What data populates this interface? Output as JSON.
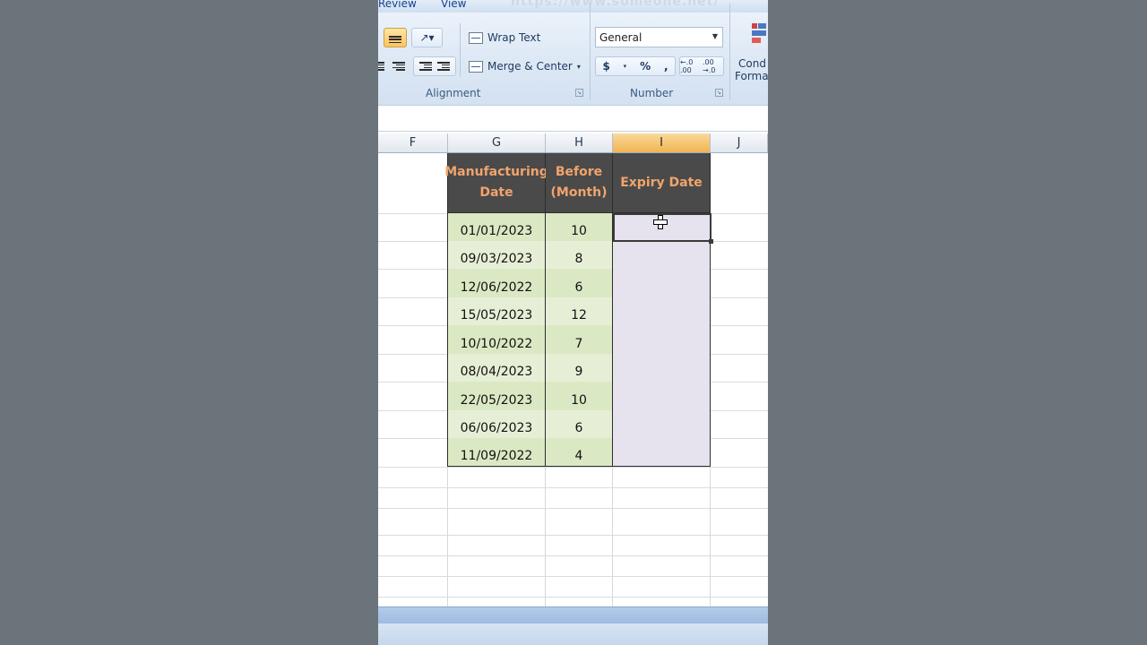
{
  "ribbon": {
    "tabs": [
      "Review",
      "View"
    ],
    "watermark": "https://www.someone.net/",
    "alignment": {
      "wrap_text": "Wrap Text",
      "merge_center": "Merge & Center",
      "group_label": "Alignment"
    },
    "number": {
      "format_value": "General",
      "currency": "$",
      "percent": "%",
      "comma": ",",
      "increase_decimal": "←.0 .00",
      "decrease_decimal": ".00 →.0",
      "group_label": "Number"
    },
    "styles": {
      "conditional_formatting_line1": "Cond",
      "conditional_formatting_line2": "Forma"
    }
  },
  "sheet": {
    "columns": [
      "F",
      "G",
      "H",
      "I",
      "J"
    ],
    "selected_column": "I",
    "headers": {
      "g": "Manufacturing Date",
      "h": "Before (Month)",
      "i": "Expiry Date"
    },
    "rows": [
      {
        "date": "01/01/2023",
        "months": "10",
        "expiry": ""
      },
      {
        "date": "09/03/2023",
        "months": "8",
        "expiry": ""
      },
      {
        "date": "12/06/2022",
        "months": "6",
        "expiry": ""
      },
      {
        "date": "15/05/2023",
        "months": "12",
        "expiry": ""
      },
      {
        "date": "10/10/2022",
        "months": "7",
        "expiry": ""
      },
      {
        "date": "08/04/2023",
        "months": "9",
        "expiry": ""
      },
      {
        "date": "22/05/2023",
        "months": "10",
        "expiry": ""
      },
      {
        "date": "06/06/2023",
        "months": "6",
        "expiry": ""
      },
      {
        "date": "11/09/2022",
        "months": "4",
        "expiry": ""
      }
    ]
  },
  "colors": {
    "header_bg": "#4a4a4a",
    "header_text": "#f1a46c",
    "date_fill": "#dbe8c4",
    "expiry_fill": "#e6e2ee",
    "selected_column": "#f2b552"
  }
}
